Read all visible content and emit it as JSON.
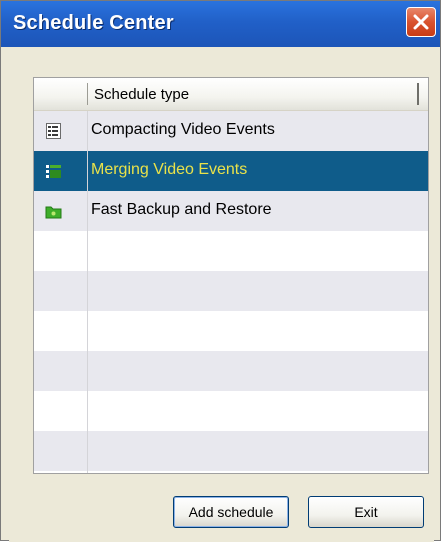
{
  "window": {
    "title": "Schedule Center",
    "accent_color": "#2160c8",
    "close_icon": "close-icon"
  },
  "list": {
    "column_header": "Schedule type",
    "items": [
      {
        "label": "Compacting Video Events",
        "icon": "document-list-icon",
        "selected": false
      },
      {
        "label": "Merging Video Events",
        "icon": "merge-grid-icon",
        "selected": true
      },
      {
        "label": "Fast Backup and Restore",
        "icon": "green-folder-icon",
        "selected": false
      }
    ],
    "selection_color": "#0f5c8a",
    "selected_text_color": "#e9e24a"
  },
  "buttons": {
    "add_schedule": "Add schedule",
    "exit": "Exit"
  }
}
